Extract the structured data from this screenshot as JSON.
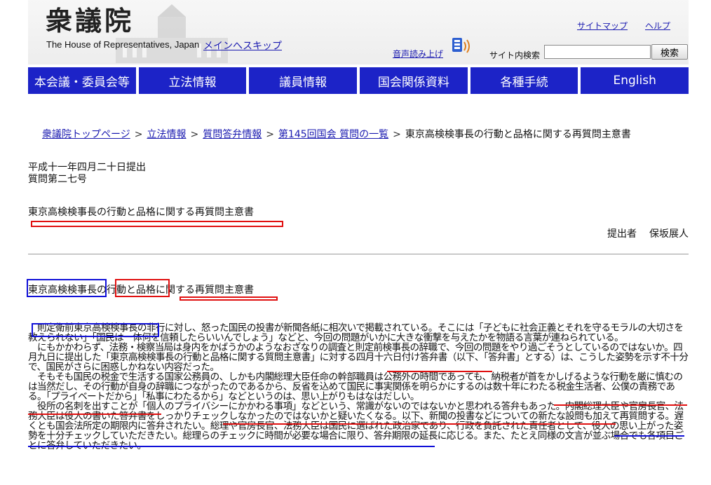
{
  "header": {
    "logo": "衆議院",
    "subtitle": "The House of Representatives, Japan",
    "skip_link": "メインへスキップ",
    "sitemap": "サイトマップ",
    "help": "ヘルプ",
    "voice": "音声読み上げ",
    "site_search_label": "サイト内検索",
    "search_value": "",
    "search_button": "検索"
  },
  "nav": [
    "本会議・委員会等",
    "立法情報",
    "議員情報",
    "国会関係資料",
    "各種手続",
    "English"
  ],
  "breadcrumb": {
    "items": [
      "衆議院トップページ",
      "立法情報",
      "質問答弁情報",
      "第145回国会 質問の一覧"
    ],
    "current": "東京高検検事長の行動と品格に関する再質問主意書",
    "separator": ">"
  },
  "doc": {
    "date": "平成十一年四月二十日提出",
    "number": "質問第二七号",
    "title": "東京高検検事長の行動と品格に関する再質問主意書",
    "submitter_label": "提出者",
    "submitter_name": "保坂展人",
    "body_title": {
      "part1": "東京高検検事長",
      "part2": "の",
      "part3": "行動と品格",
      "part4": "に関する再質問主意書"
    },
    "paragraphs": [
      "　則定衛前東京高検検事長の非行に対し、怒った国民の投書が新聞各紙に相次いで掲載されている。そこには「子どもに社会正義とそれを守るモラルの大切さを教えられない」「国民は一体何を信頼したらいいんでしょう」などと、今回の問題がいかに大きな衝撃を与えたかを物語る言葉が連ねられている。",
      "　にもかかわらず、法務・検察当局は身内をかばうかのようなおざなりの調査と則定前検事長の辞職で、今回の問題をやり過ごそうとしているのではないか。四月九日に提出した「東京高検検事長の行動と品格に関する質問主意書」に対する四月十六日付け答弁書（以下、「答弁書」とする）は、こうした姿勢を示す不十分で、国民がさらに困惑しかねない内容だった。",
      "　そもそも国民の税金で生活する国家公務員の、しかも内閣総理大臣任命の幹部職員は公務外の時間であっても、納税者が首をかしげるような行動を厳に慎むのは当然だし、その行動が自身の辞職につながったのであるから、反省を込めて国民に事実関係を明らかにするのは数十年にわたる税金生活者、公僕の責務である。「プライベートだから」「私事にわたるから」などというのは、思い上がりもはなはだしい。",
      "　役所の名刺を出すことが「個人のプライバシーにかかわる事項」などという、常識がないのではないかと思われる答弁もあった。内閣総理大臣や官房長官、法務大臣は役人の書いた答弁書をしっかりチェックしなかったのではないかと疑いたくなる。以下、新聞の投書などについての新たな設問も加えて再質問する。遅くとも国会法所定の期限内に答弁されたい。総理や官房長官、法務大臣は国民に選ばれた政治家であり、行政を負託された責任者として、役人の思い上がった姿勢を十分チェックしていただきたい。総理らのチェックに時間が必要な場合に限り、答弁期限の延長に応じる。また、たとえ同様の文言が並ぶ場合でも各項目ごとに答弁していただきたい。"
    ]
  },
  "colors": {
    "nav_bg": "#1c23c7",
    "link": "#1a1ab0",
    "annotation_red": "#e01010",
    "annotation_blue": "#1010d8"
  }
}
